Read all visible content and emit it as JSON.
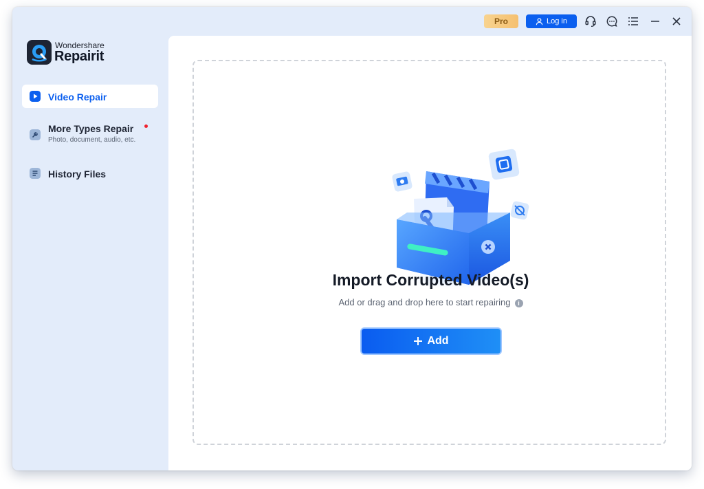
{
  "titlebar": {
    "pro_label": "Pro",
    "login_label": "Log in",
    "icons": [
      "user-icon",
      "headset-icon",
      "chat-icon",
      "menu-icon",
      "minimize-icon",
      "close-icon"
    ]
  },
  "brand": {
    "company": "Wondershare",
    "product": "Repairit"
  },
  "sidebar": {
    "items": [
      {
        "label": "Video Repair",
        "active": true
      },
      {
        "label": "More Types Repair",
        "sub": "Photo, document, audio, etc.",
        "badge": "new-dot"
      },
      {
        "label": "History Files"
      }
    ]
  },
  "main": {
    "title": "Import Corrupted Video(s)",
    "subtitle": "Add or drag and drop here to start repairing",
    "add_label": "Add"
  },
  "colors": {
    "accent": "#0b5fef",
    "sidebar_bg": "#e3ecfa",
    "pro": "#f5c070",
    "dot": "#f0222f"
  }
}
